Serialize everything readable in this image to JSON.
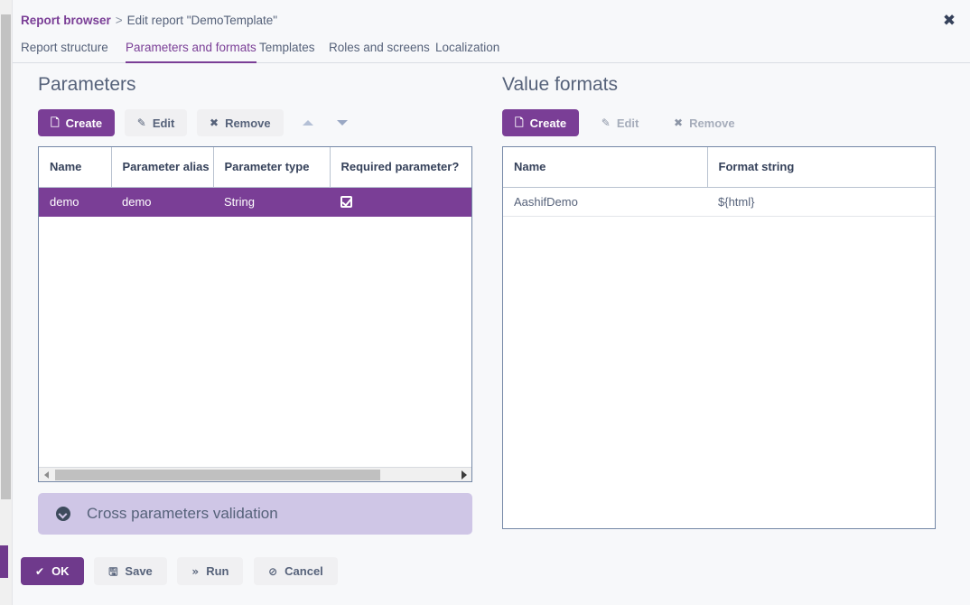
{
  "breadcrumb": {
    "link": "Report browser",
    "separator": ">",
    "current": "Edit report \"DemoTemplate\""
  },
  "close_icon": "✖",
  "tabs": [
    {
      "label": "Report structure",
      "active": false
    },
    {
      "label": "Parameters and formats",
      "active": true
    },
    {
      "label": "Templates",
      "active": false
    },
    {
      "label": "Roles and screens",
      "active": false
    },
    {
      "label": "Localization",
      "active": false
    }
  ],
  "parameters_panel": {
    "title": "Parameters",
    "toolbar": {
      "create_label": "Create",
      "create_icon": "🗋",
      "edit_label": "Edit",
      "edit_icon": "✎",
      "remove_label": "Remove",
      "remove_icon": "✖",
      "move_up_icon": "triangle-up",
      "move_down_icon": "triangle-down"
    },
    "columns": [
      "Name",
      "Parameter alias",
      "Parameter type",
      "Required parameter?"
    ],
    "rows": [
      {
        "name": "demo",
        "alias": "demo",
        "type": "String",
        "required": true,
        "selected": true
      }
    ]
  },
  "value_formats_panel": {
    "title": "Value formats",
    "toolbar": {
      "create_label": "Create",
      "create_icon": "🗋",
      "edit_label": "Edit",
      "edit_icon": "✎",
      "remove_label": "Remove",
      "remove_icon": "✖"
    },
    "columns": [
      "Name",
      "Format string"
    ],
    "rows": [
      {
        "name": "AashifDemo",
        "format_string": "${html}",
        "selected": false
      }
    ]
  },
  "cross_parameters_validation": {
    "label": "Cross parameters validation",
    "icon": "chevron-down-circle-icon"
  },
  "footer": {
    "ok_label": "OK",
    "ok_icon": "✔",
    "save_label": "Save",
    "save_icon": "🖫",
    "run_label": "Run",
    "run_icon": "»",
    "cancel_label": "Cancel",
    "cancel_icon": "⊘"
  },
  "colors": {
    "accent_purple": "#7a3e96",
    "footer_purple": "#6f3a8c",
    "page_bg": "#f7f8fa",
    "panel_bg": "#ffffff",
    "grid_border": "#7487a6",
    "section_bg": "#cfc6e6",
    "text": "#56627a"
  }
}
